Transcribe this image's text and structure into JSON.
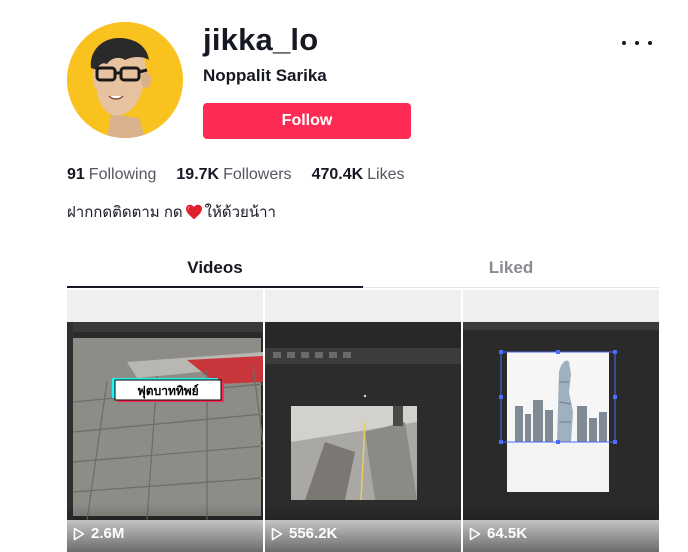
{
  "profile": {
    "username": "jikka_lo",
    "display_name": "Noppalit Sarika",
    "follow_label": "Follow",
    "avatar_bg": "#f9c21f",
    "bio_before": "ฝากกดติดตาม กด",
    "bio_after": "ให้ด้วยน้าา",
    "heart_icon": "red-heart-emoji"
  },
  "stats": {
    "following_count": "91",
    "following_label": "Following",
    "followers_count": "19.7K",
    "followers_label": "Followers",
    "likes_count": "470.4K",
    "likes_label": "Likes"
  },
  "tabs": [
    {
      "label": "Videos",
      "active": true
    },
    {
      "label": "Liked",
      "active": false
    }
  ],
  "videos": [
    {
      "views": "2.6M",
      "caption": "ฟุตบาททิพย์",
      "icon": "play-icon"
    },
    {
      "views": "556.2K",
      "icon": "play-icon"
    },
    {
      "views": "64.5K",
      "icon": "play-icon"
    }
  ],
  "colors": {
    "accent": "#fe2c55",
    "text": "#161823",
    "muted": "#8a8b91"
  }
}
